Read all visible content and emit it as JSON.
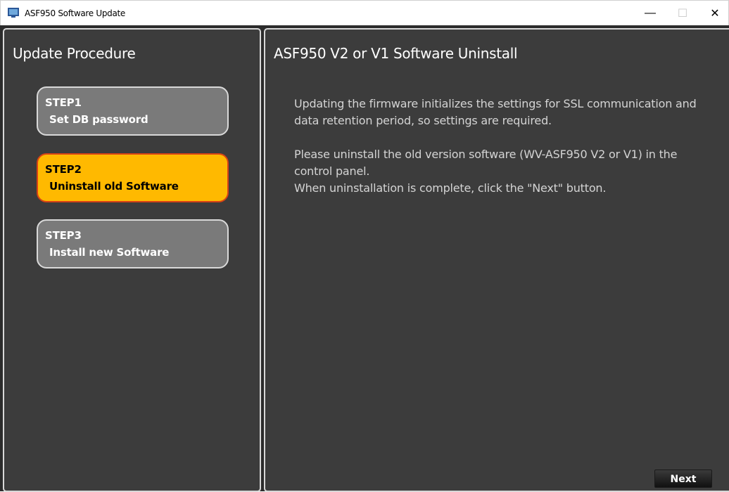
{
  "window": {
    "title": "ASF950 Software Update",
    "controls": {
      "minimize": "—",
      "maximize": "☐",
      "close": "✕"
    }
  },
  "left_panel": {
    "heading": "Update Procedure",
    "steps": [
      {
        "title": "STEP1",
        "label": "Set DB password",
        "active": false
      },
      {
        "title": "STEP2",
        "label": "Uninstall old Software",
        "active": true
      },
      {
        "title": "STEP3",
        "label": "Install new Software",
        "active": false
      }
    ]
  },
  "right_panel": {
    "heading": "ASF950 V2 or V1 Software Uninstall",
    "paragraph1": "Updating the firmware initializes the settings for SSL communication and data retention period, so settings are required.",
    "paragraph2_line1": "Please uninstall the old version software (WV-ASF950 V2 or V1) in the control panel.",
    "paragraph2_line2": "When uninstallation is complete, click the \"Next\" button.",
    "next_label": "Next"
  },
  "colors": {
    "active_step": "#ffb900",
    "active_border": "#d84315",
    "inactive_step": "#7a7a7a",
    "panel_bg": "#3c3c3c"
  }
}
